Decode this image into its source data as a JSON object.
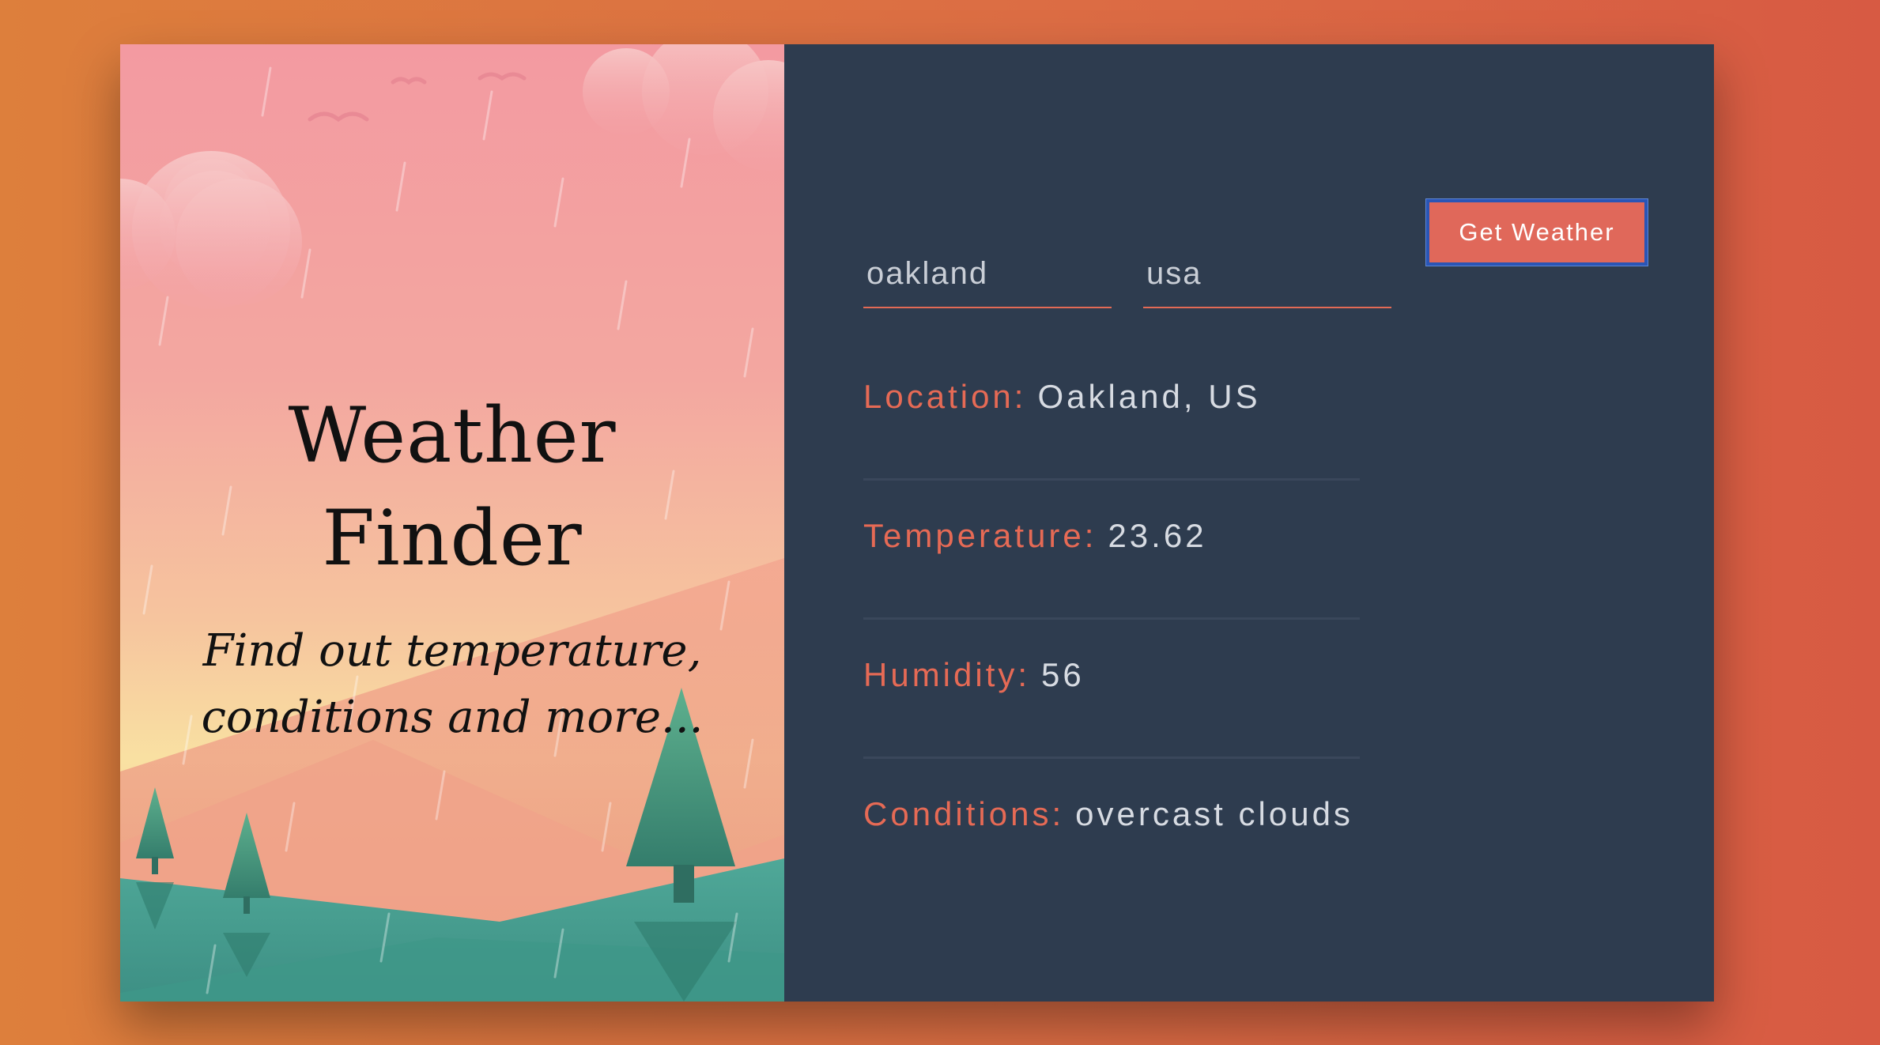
{
  "hero": {
    "title_line1": "Weather",
    "title_line2": "Finder",
    "subtitle_line1": "Find out temperature,",
    "subtitle_line2": "conditions and more..."
  },
  "form": {
    "city_value": "oakland",
    "country_value": "usa",
    "submit_label": "Get Weather"
  },
  "results": [
    {
      "label": "Location:",
      "value": "Oakland, US"
    },
    {
      "label": "Temperature:",
      "value": "23.62"
    },
    {
      "label": "Humidity:",
      "value": "56"
    },
    {
      "label": "Conditions:",
      "value": "overcast clouds"
    }
  ],
  "colors": {
    "accent": "#e36a55",
    "panel": "#2e3c4f",
    "button_focus_ring": "#2a55b5"
  }
}
